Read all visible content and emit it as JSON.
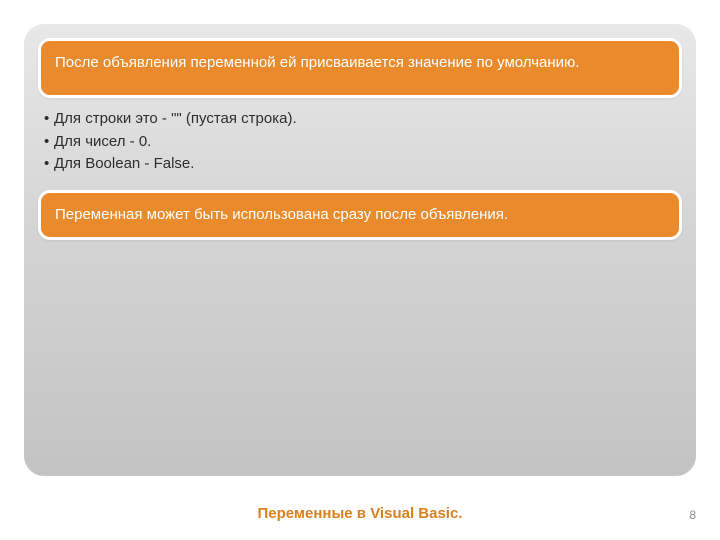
{
  "callouts": {
    "first": "После объявления переменной ей присваивается значение по умолчанию.",
    "second": "Переменная может быть использована сразу после объявления."
  },
  "bullets": [
    "Для строки это - \"\" (пустая строка).",
    "Для чисел - 0.",
    "Для Boolean - False."
  ],
  "footer": {
    "title": "Переменные в Visual Basic.",
    "page": "8"
  }
}
